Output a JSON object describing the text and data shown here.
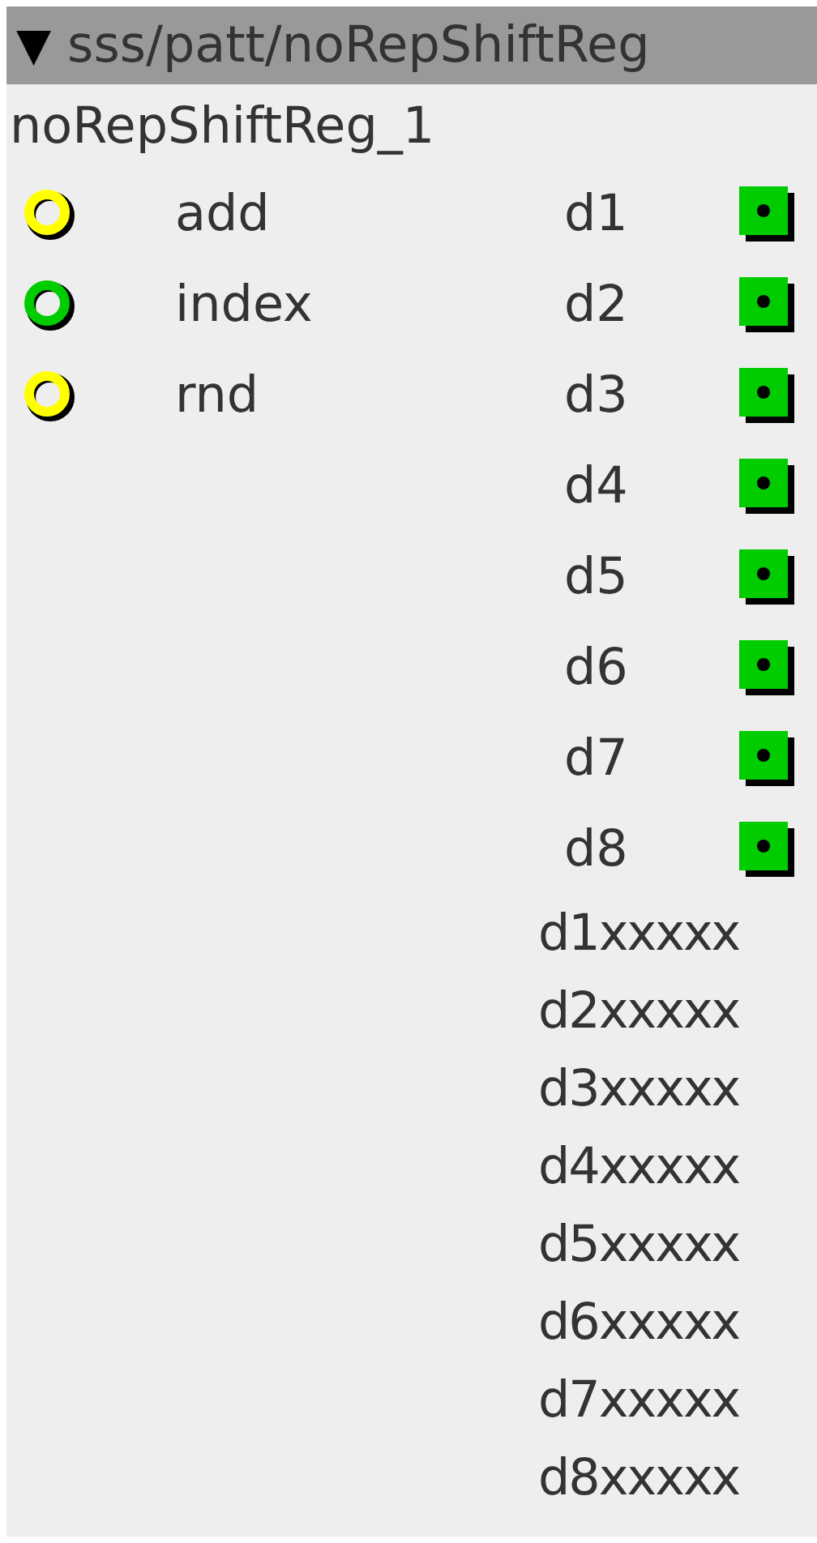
{
  "header": {
    "toggle": "▼",
    "title": "sss/patt/noRepShiftReg"
  },
  "instance_name": "noRepShiftReg_1",
  "inlets": [
    {
      "name": "add",
      "color": "#ffff00"
    },
    {
      "name": "index",
      "color": "#00cc00"
    },
    {
      "name": "rnd",
      "color": "#ffff00"
    }
  ],
  "outlets": [
    {
      "name": "d1",
      "color": "#00cc00"
    },
    {
      "name": "d2",
      "color": "#00cc00"
    },
    {
      "name": "d3",
      "color": "#00cc00"
    },
    {
      "name": "d4",
      "color": "#00cc00"
    },
    {
      "name": "d5",
      "color": "#00cc00"
    },
    {
      "name": "d6",
      "color": "#00cc00"
    },
    {
      "name": "d7",
      "color": "#00cc00"
    },
    {
      "name": "d8",
      "color": "#00cc00"
    }
  ],
  "displays": [
    "d1xxxxx",
    "d2xxxxx",
    "d3xxxxx",
    "d4xxxxx",
    "d5xxxxx",
    "d6xxxxx",
    "d7xxxxx",
    "d8xxxxx"
  ]
}
